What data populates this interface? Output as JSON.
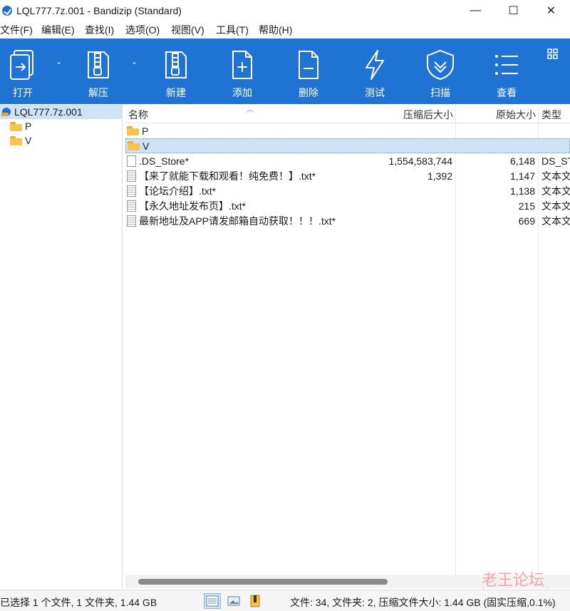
{
  "window": {
    "title": "LQL777.7z.001 - Bandizip (Standard)",
    "controls": [
      "—",
      "☐",
      "✕"
    ]
  },
  "menu": [
    "文件(F)",
    "编辑(E)",
    "查找(I)",
    "选项(O)",
    "视图(V)",
    "工具(T)",
    "帮助(H)"
  ],
  "toolbar": {
    "accent": "#1f73d2",
    "buttons": [
      {
        "label": "打开",
        "icon": "open-icon"
      },
      {
        "label": "解压",
        "icon": "extract-icon"
      },
      {
        "label": "新建",
        "icon": "new-archive-icon"
      },
      {
        "label": "添加",
        "icon": "add-file-icon"
      },
      {
        "label": "删除",
        "icon": "delete-file-icon"
      },
      {
        "label": "测试",
        "icon": "test-icon"
      },
      {
        "label": "扫描",
        "icon": "scan-shield-icon"
      },
      {
        "label": "查看",
        "icon": "view-list-icon"
      }
    ]
  },
  "tree": {
    "root": "LQL777.7z.001",
    "children": [
      "P",
      "V"
    ]
  },
  "list": {
    "columns": {
      "name": "名称",
      "packed": "压缩后大小",
      "original": "原始大小",
      "type": "类型"
    },
    "rows": [
      {
        "name": "P",
        "kind": "folder",
        "packed": "",
        "original": "",
        "type": ""
      },
      {
        "name": "V",
        "kind": "folder",
        "packed": "",
        "original": "",
        "type": "",
        "selected": true
      },
      {
        "name": ".DS_Store*",
        "kind": "file",
        "packed": "1,554,583,744",
        "original": "6,148",
        "type": "DS_ST"
      },
      {
        "name": "【来了就能下载和观看！纯免费！】.txt*",
        "kind": "txt",
        "packed": "1,392",
        "original": "1,147",
        "type": "文本文"
      },
      {
        "name": "【论坛介绍】.txt*",
        "kind": "txt",
        "packed": "",
        "original": "1,138",
        "type": "文本文"
      },
      {
        "name": "【永久地址发布页】.txt*",
        "kind": "txt",
        "packed": "",
        "original": "215",
        "type": "文本文"
      },
      {
        "name": "最新地址及APP请发邮箱自动获取！！！.txt*",
        "kind": "txt",
        "packed": "",
        "original": "669",
        "type": "文本文"
      }
    ]
  },
  "status": {
    "left": "已选择 1 个文件, 1 文件夹, 1.44 GB",
    "right": "文件: 34, 文件夹: 2, 压缩文件大小: 1.44 GB (固实压缩,0.1%)"
  },
  "watermark": {
    "line1": "老王论坛",
    "line2": "laowang.vip"
  }
}
